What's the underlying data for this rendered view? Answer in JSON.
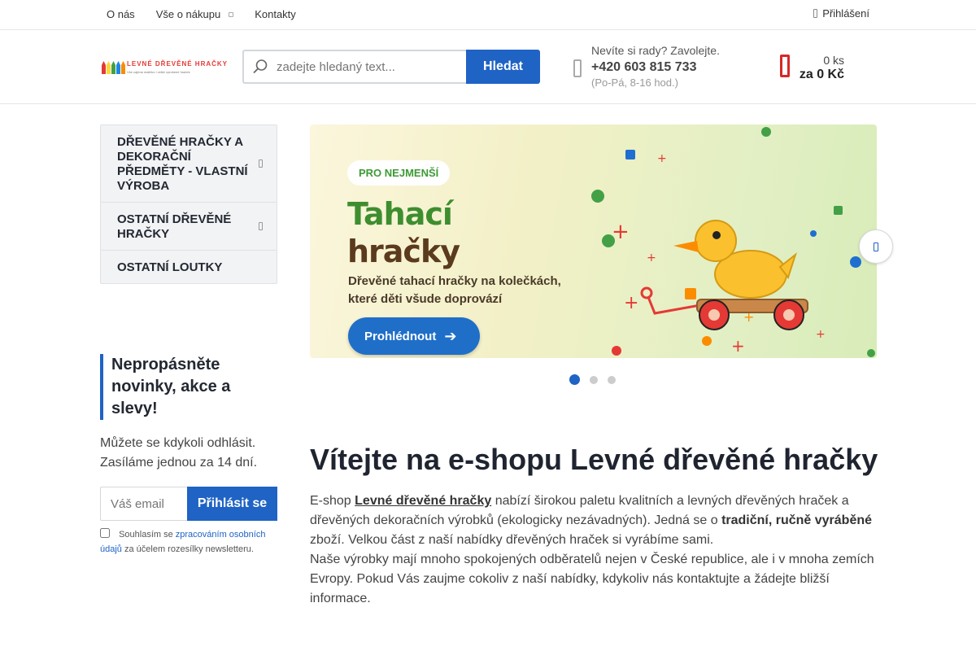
{
  "topbar": {
    "nav": [
      "O nás",
      "Vše o nákupu",
      "Kontakty"
    ],
    "login": "Přihlášení"
  },
  "header": {
    "logo_text": "LEVNÉ DŘEVĚNÉ HRAČKY",
    "logo_tagline": "Vše zajímá maličko i velké vyrobené hraček",
    "search_placeholder": "zadejte hledaný text...",
    "search_button": "Hledat",
    "contact_question": "Nevíte si rady? Zavolejte.",
    "contact_phone": "+420 603 815 733",
    "contact_hours": "(Po-Pá, 8-16 hod.)",
    "cart_count": "0 ks",
    "cart_total": "za 0 Kč"
  },
  "categories": [
    "DŘEVĚNÉ HRAČKY A DEKORAČNÍ PŘEDMĚTY - VLASTNÍ VÝROBA",
    "OSTATNÍ DŘEVĚNÉ HRAČKY",
    "OSTATNÍ LOUTKY"
  ],
  "newsletter": {
    "title": "Nepropásněte novinky, akce a slevy!",
    "text": "Můžete se kdykoli odhlásit. Zasíláme jednou za 14 dní.",
    "email_placeholder": "Váš email",
    "button": "Přihlásit se",
    "consent_prefix": "Souhlasím se",
    "consent_link": "zpracováním osobních údajů",
    "consent_suffix": "za účelem rozesílky newsletteru."
  },
  "banner": {
    "pill": "PRO NEJMENŠÍ",
    "title_line1": "Tahací",
    "title_line2": "hračky",
    "subtitle": "Dřevěné tahací hračky na kolečkách, které děti všude doprovází",
    "button": "Prohlédnout",
    "slides_total": 3,
    "slide_active": 1
  },
  "welcome": {
    "heading": "Vítejte na e-shopu Levné dřevěné hračky",
    "p_start": "E-shop",
    "p_brand": "Levné dřevěné hračky",
    "p_mid": "nabízí širokou paletu kvalitních a levných dřevěných hraček a dřevěných dekoračních výrobků (ekologicky nezávadných). Jedná se o",
    "p_bold": "tradiční, ručně vyráběné",
    "p_end": "zboží. Velkou část z naší nabídky dřevěných hraček si vyrábíme sami.",
    "p2": "Naše výrobky mají mnoho spokojených odběratelů nejen v České republice, ale i v mnoha zemích Evropy. Pokud Vás zaujme cokoliv z naší nabídky, kdykoliv nás kontaktujte a žádejte bližší informace."
  },
  "colors": {
    "accent": "#1f63c4",
    "cart": "#d62828",
    "banner_green": "#3e8e2f",
    "banner_brown": "#5b3a1e"
  }
}
